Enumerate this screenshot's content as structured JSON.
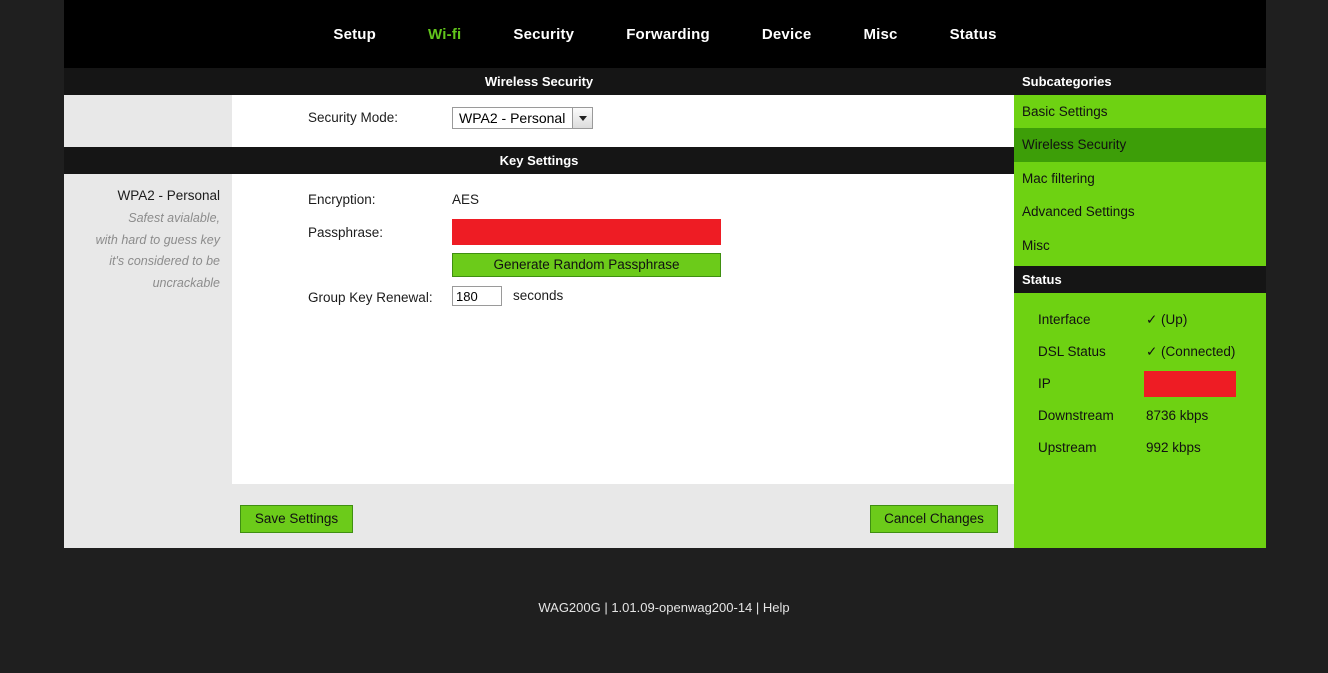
{
  "nav": {
    "items": [
      {
        "label": "Setup",
        "active": false
      },
      {
        "label": "Wi-fi",
        "active": true
      },
      {
        "label": "Security",
        "active": false
      },
      {
        "label": "Forwarding",
        "active": false
      },
      {
        "label": "Device",
        "active": false
      },
      {
        "label": "Misc",
        "active": false
      },
      {
        "label": "Status",
        "active": false
      }
    ],
    "active_color": "#62c61c"
  },
  "main": {
    "title": "Wireless Security",
    "key_settings_title": "Key Settings",
    "security_mode": {
      "label": "Security Mode:",
      "value": "WPA2 - Personal",
      "arrow_icon": "chevron-down-icon"
    },
    "help": {
      "title": "WPA2 - Personal",
      "lines": [
        "Safest avialable,",
        "with hard to guess key",
        "it's considered to be",
        "uncrackable"
      ]
    },
    "fields": {
      "encryption_label": "Encryption:",
      "encryption_value": "AES",
      "passphrase_label": "Passphrase:",
      "passphrase_value": "",
      "generate_button": "Generate Random Passphrase",
      "group_key_label": "Group Key Renewal:",
      "group_key_value": "180",
      "group_key_units": "seconds"
    },
    "buttons": {
      "save": "Save Settings",
      "cancel": "Cancel Changes"
    }
  },
  "sidebar": {
    "title": "Subcategories",
    "items": [
      {
        "label": "Basic Settings",
        "active": false
      },
      {
        "label": "Wireless Security",
        "active": true
      },
      {
        "label": "Mac filtering",
        "active": false
      },
      {
        "label": "Advanced Settings",
        "active": false
      },
      {
        "label": "Misc",
        "active": false
      }
    ],
    "green": "#6ed212",
    "active_green": "#3d9e08"
  },
  "status": {
    "title": "Status",
    "rows": [
      {
        "key": "Interface",
        "value": "✓ (Up)",
        "redacted": false
      },
      {
        "key": "DSL Status",
        "value": "✓ (Connected)",
        "redacted": false
      },
      {
        "key": "IP",
        "value": "",
        "redacted": true
      },
      {
        "key": "Downstream",
        "value": "8736 kbps",
        "redacted": false
      },
      {
        "key": "Upstream",
        "value": "992 kbps",
        "redacted": false
      }
    ],
    "redaction_color": "#ee1c24"
  },
  "footer": {
    "model": "WAG200G",
    "separator_1": "|",
    "firmware": "1.01.09-openwag200-14",
    "separator_2": "|",
    "help_link": "Help",
    "full_text": "WAG200G | 1.01.09-openwag200-14 | Help"
  }
}
